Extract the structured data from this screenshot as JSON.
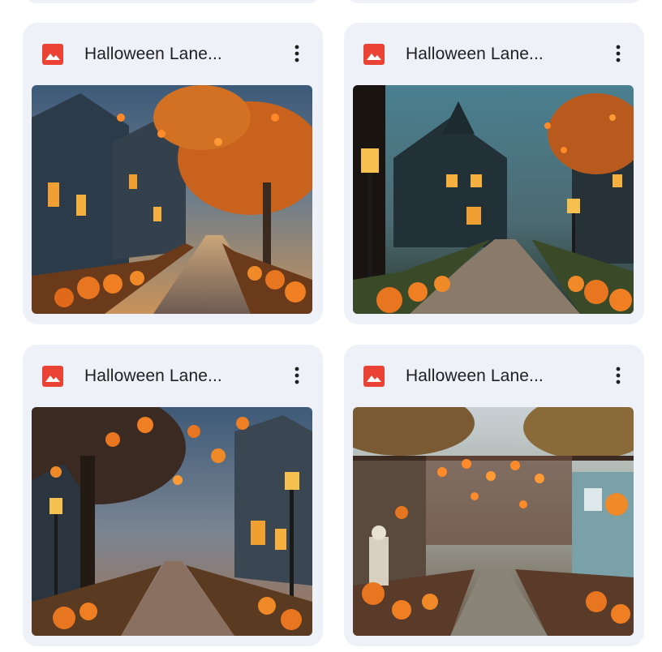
{
  "files": [
    {
      "title": "Halloween Lane...",
      "type_icon": "image-icon",
      "menu_icon": "more-vert-icon"
    },
    {
      "title": "Halloween Lane...",
      "type_icon": "image-icon",
      "menu_icon": "more-vert-icon"
    },
    {
      "title": "Halloween Lane...",
      "type_icon": "image-icon",
      "menu_icon": "more-vert-icon"
    },
    {
      "title": "Halloween Lane...",
      "type_icon": "image-icon",
      "menu_icon": "more-vert-icon"
    }
  ],
  "colors": {
    "card_bg": "#eef1f7",
    "icon_red": "#ea4335",
    "title_text": "#1f1f1f"
  }
}
